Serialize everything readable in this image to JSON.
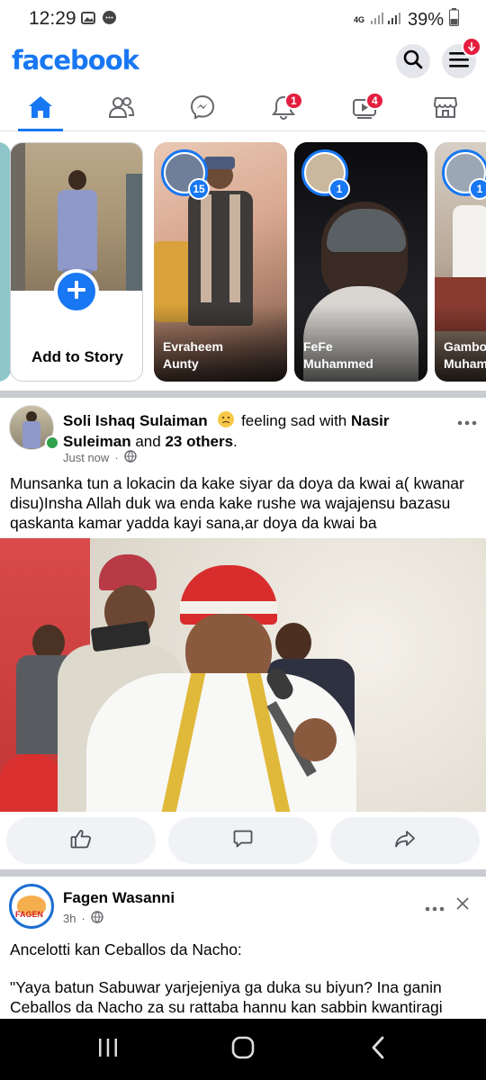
{
  "status_bar": {
    "time": "12:29",
    "network": "4G",
    "battery": "39%"
  },
  "header": {
    "logo": "facebook",
    "search_icon": "search-icon",
    "menu_icon": "menu-icon"
  },
  "tabs": [
    {
      "name": "home",
      "icon": "home-icon",
      "badge": ""
    },
    {
      "name": "friends",
      "icon": "friends-icon",
      "badge": ""
    },
    {
      "name": "messenger",
      "icon": "messenger-icon",
      "badge": ""
    },
    {
      "name": "notifications",
      "icon": "bell-icon",
      "badge": "1"
    },
    {
      "name": "video",
      "icon": "video-icon",
      "badge": "4"
    },
    {
      "name": "marketplace",
      "icon": "marketplace-icon",
      "badge": ""
    }
  ],
  "stories": {
    "add_label": "Add to Story",
    "items": [
      {
        "name_line1": "Evraheem",
        "name_line2": "Aunty",
        "count": "15"
      },
      {
        "name_line1": "FeFe",
        "name_line2": "Muhammed",
        "count": "1"
      },
      {
        "name_line1": "Gambo",
        "name_line2": "Muham",
        "count": "1"
      }
    ]
  },
  "post1": {
    "author": "Soli Ishaq Sulaiman",
    "feeling": "feeling sad with",
    "tag1": "Nasir",
    "tag1b": "Suleiman",
    "and": "and",
    "others": "23 others",
    "period": ".",
    "time": "Just now",
    "dot": "·",
    "text": "Munsanka tun a lokacin da kake siyar da doya da kwai a( kwanar disu)Insha Allah duk wa enda kake rushe wa wajajensu bazasu qaskanta kamar yadda kayi sana,ar doya da kwai ba"
  },
  "post2": {
    "author": "Fagen Wasanni",
    "logo_text": "FAGEN",
    "time": "3h",
    "dot": "·",
    "line1": "Ancelotti kan Ceballos da Nacho:",
    "line2": "\"Yaya batun Sabuwar yarjejeniya ga duka su biyun?  Ina ganin Ceballos da Nacho za su rattaba hannu kan sabbin kwantiragi"
  },
  "colors": {
    "brand": "#1877f2",
    "badge": "#e41e3f",
    "separator": "#c9ccd1"
  }
}
